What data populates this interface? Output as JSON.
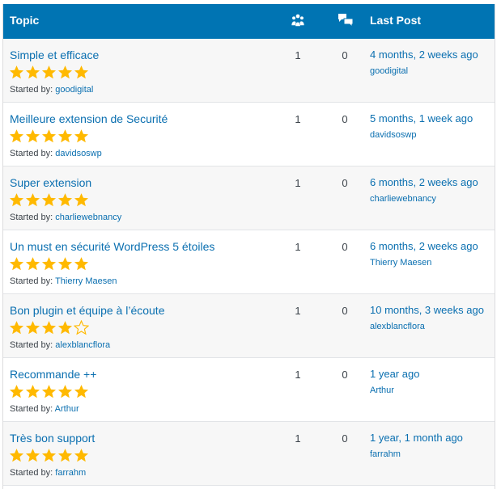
{
  "header": {
    "topic_label": "Topic",
    "voices_icon": "voices-icon",
    "replies_icon": "replies-icon",
    "last_post_label": "Last Post"
  },
  "colors": {
    "accent": "#0074b3",
    "link": "#0a6fb0",
    "star": "#ffb900"
  },
  "started_by_label": "Started by:",
  "topics": [
    {
      "title": "Simple et efficace",
      "rating": 5,
      "started_by": "goodigital",
      "voices": "1",
      "replies": "0",
      "last_post_time": "4 months, 2 weeks ago",
      "last_post_user": "goodigital"
    },
    {
      "title": "Meilleure extension de Securité",
      "rating": 5,
      "started_by": "davidsoswp",
      "voices": "1",
      "replies": "0",
      "last_post_time": "5 months, 1 week ago",
      "last_post_user": "davidsoswp"
    },
    {
      "title": "Super extension",
      "rating": 5,
      "started_by": "charliewebnancy",
      "voices": "1",
      "replies": "0",
      "last_post_time": "6 months, 2 weeks ago",
      "last_post_user": "charliewebnancy"
    },
    {
      "title": "Un must en sécurité WordPress 5 étoiles",
      "rating": 5,
      "started_by": "Thierry Maesen",
      "voices": "1",
      "replies": "0",
      "last_post_time": "6 months, 2 weeks ago",
      "last_post_user": "Thierry Maesen"
    },
    {
      "title": "Bon plugin et équipe à l’écoute",
      "rating": 4,
      "started_by": "alexblancflora",
      "voices": "1",
      "replies": "0",
      "last_post_time": "10 months, 3 weeks ago",
      "last_post_user": "alexblancflora"
    },
    {
      "title": "Recommande ++",
      "rating": 5,
      "started_by": "Arthur",
      "voices": "1",
      "replies": "0",
      "last_post_time": "1 year ago",
      "last_post_user": "Arthur"
    },
    {
      "title": "Très bon support",
      "rating": 5,
      "started_by": "farrahm",
      "voices": "1",
      "replies": "0",
      "last_post_time": "1 year, 1 month ago",
      "last_post_user": "farrahm"
    }
  ]
}
